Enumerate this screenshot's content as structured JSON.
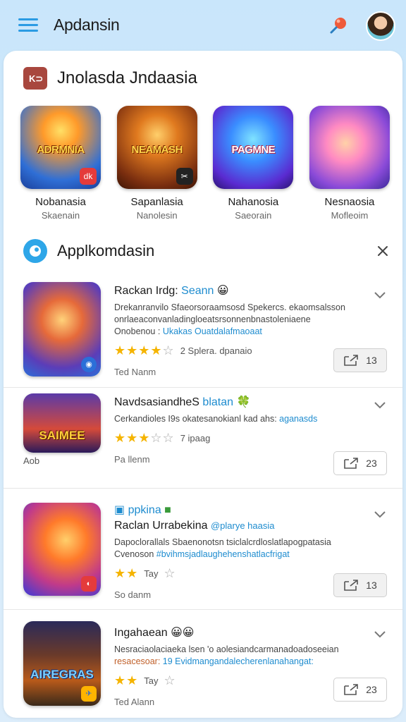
{
  "app": {
    "title": "Apdansin"
  },
  "featured": {
    "title": "Jnolasda Jndaasia",
    "items": [
      {
        "name": "Nobanasia",
        "sub": "Skaenain",
        "art": "ADRMNIA",
        "badge": "dk"
      },
      {
        "name": "Sapanlasia",
        "sub": "Nanolesin",
        "art": "NEAMASH",
        "badge": "✂"
      },
      {
        "name": "Nahanosia",
        "sub": "Saeorain",
        "art": "PAGMNE",
        "badge": ""
      },
      {
        "name": "Nesnaosia",
        "sub": "Mofleoim",
        "art": "",
        "badge": ""
      }
    ]
  },
  "recommended": {
    "title": "Applkomdasin",
    "items": [
      {
        "name": "Rackan Irdg: ",
        "name_tag": "Seann",
        "desc1": "Drekanranvilo Sfaeorsoraamsosd Spekercs. ekaomsalsson",
        "desc2": "onrlaeaconvanladingloeatsrsonnenbnastoleniaene",
        "desc3a": "Onobenou : ",
        "desc3b": "Ukakas Ouatdalafmaoaat",
        "rating_text": "2 Splera. dpanaio",
        "meta": "Ted Nanm",
        "button": "13",
        "stars": 4
      },
      {
        "name": "NavdsasiandheS ",
        "name_tag": "blatan",
        "desc1": "Cerkandioles I9s okatesanokianl kad ahs: ",
        "desc1_hl": "aganasds",
        "rating_text": "7 ipaag",
        "meta": "Pa llenm",
        "label": "Aob",
        "button": "23",
        "art": "SAIMEE",
        "stars": 3
      },
      {
        "name_top": "ppkina",
        "name": "Raclan Urrabekina ",
        "name_tag": "@plarye haasia",
        "desc1": "Dapoclorallals Sbaenonotsn tsiclalcrdloslatlapogpatasia",
        "desc2a": "Cvenoson ",
        "desc2b": "#bvihmsjadlaughehenshatlacfrigat",
        "rating_text": "Tay",
        "meta": "So danm",
        "button": "13",
        "stars": 2
      },
      {
        "name": "Ingahaean ",
        "name_tag": "",
        "desc1": "Nesraciaolaciaeka lsen 'o aolesiandcarmanadoadoseeian",
        "desc2a": "resacesoar: ",
        "desc2b": "19 Evidmangandalecherenlanahangat:",
        "rating_text": "Tay",
        "meta": "Ted Alann",
        "button": "23",
        "art": "AIREGRAS",
        "stars": 2
      }
    ]
  },
  "colors": {
    "accent": "#2b9be3",
    "star": "#f5b400",
    "link": "#1e8ccf"
  }
}
